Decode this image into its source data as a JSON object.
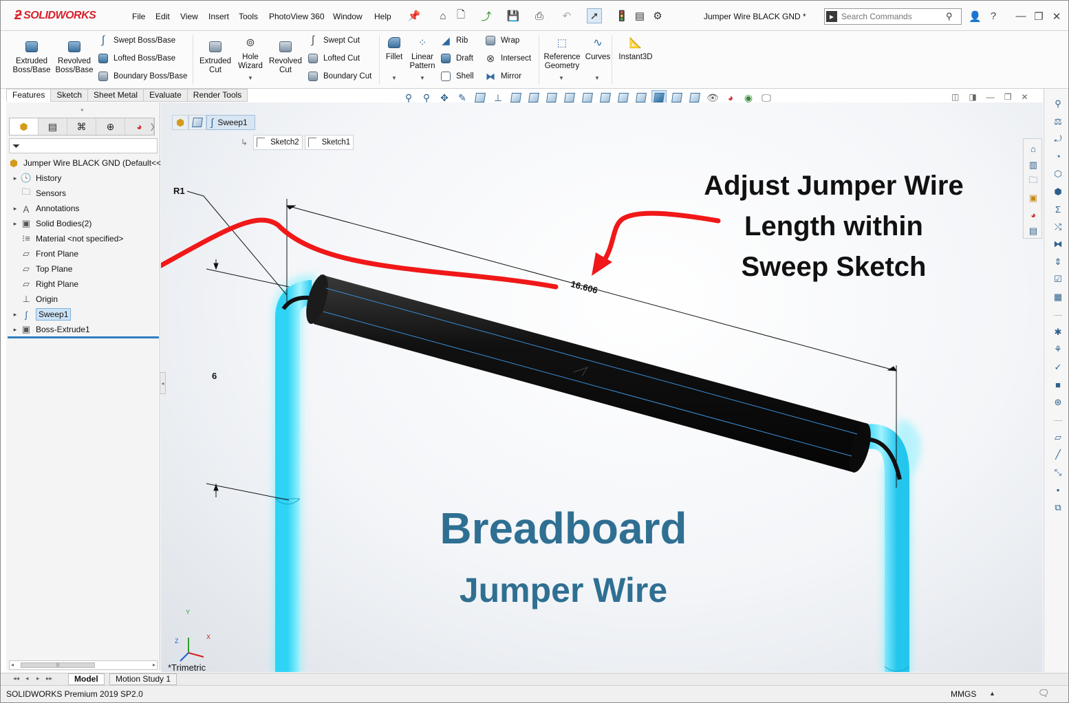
{
  "app": {
    "logo": "SOLIDWORKS",
    "document_title": "Jumper Wire BLACK GND *"
  },
  "menu": [
    "File",
    "Edit",
    "View",
    "Insert",
    "Tools",
    "PhotoView 360",
    "Window",
    "Help"
  ],
  "search": {
    "placeholder": "Search Commands"
  },
  "ribbon": {
    "extruded_boss": "Extruded\nBoss/Base",
    "revolved_boss": "Revolved\nBoss/Base",
    "swept_boss": "Swept Boss/Base",
    "lofted_boss": "Lofted Boss/Base",
    "boundary_boss": "Boundary Boss/Base",
    "extruded_cut": "Extruded\nCut",
    "hole_wizard": "Hole\nWizard",
    "revolved_cut": "Revolved\nCut",
    "swept_cut": "Swept Cut",
    "lofted_cut": "Lofted Cut",
    "boundary_cut": "Boundary Cut",
    "fillet": "Fillet",
    "linear_pattern": "Linear\nPattern",
    "rib": "Rib",
    "draft": "Draft",
    "shell": "Shell",
    "wrap": "Wrap",
    "intersect": "Intersect",
    "mirror": "Mirror",
    "reference_geometry": "Reference\nGeometry",
    "curves": "Curves",
    "instant3d": "Instant3D"
  },
  "command_tabs": [
    "Features",
    "Sketch",
    "Sheet Metal",
    "Evaluate",
    "Render Tools"
  ],
  "feature_tree": {
    "root": "Jumper Wire BLACK GND  (Default<<",
    "items": [
      {
        "label": "History",
        "expandable": true
      },
      {
        "label": "Sensors",
        "expandable": false
      },
      {
        "label": "Annotations",
        "expandable": true
      },
      {
        "label": "Solid Bodies(2)",
        "expandable": true
      },
      {
        "label": "Material <not specified>",
        "expandable": false
      },
      {
        "label": "Front Plane",
        "expandable": false
      },
      {
        "label": "Top Plane",
        "expandable": false
      },
      {
        "label": "Right Plane",
        "expandable": false
      },
      {
        "label": "Origin",
        "expandable": false
      },
      {
        "label": "Sweep1",
        "expandable": true,
        "selected": true
      },
      {
        "label": "Boss-Extrude1",
        "expandable": true
      }
    ]
  },
  "breadcrumb": {
    "feature": "Sweep1",
    "sketches": [
      "Sketch2",
      "Sketch1"
    ]
  },
  "dimensions": {
    "radius": "R1",
    "length": "16.606",
    "height": "6"
  },
  "overlay": {
    "callout_line1": "Adjust Jumper Wire",
    "callout_line2": "Length within",
    "callout_line3": "Sweep Sketch",
    "title": "Breadboard",
    "subtitle": "Jumper Wire"
  },
  "view_orientation": "*Trimetric",
  "triad": {
    "y": "Y",
    "x": "X",
    "z": "Z"
  },
  "bottom_tabs": [
    "Model",
    "Motion Study 1"
  ],
  "status": {
    "product": "SOLIDWORKS Premium 2019 SP2.0",
    "units": "MMGS"
  },
  "colors": {
    "accent": "#2f7ec0",
    "arrow_red": "#f01818",
    "title_text": "#2f6f92",
    "wire_black": "#111111",
    "wire_cyan": "#3fe0ff"
  }
}
